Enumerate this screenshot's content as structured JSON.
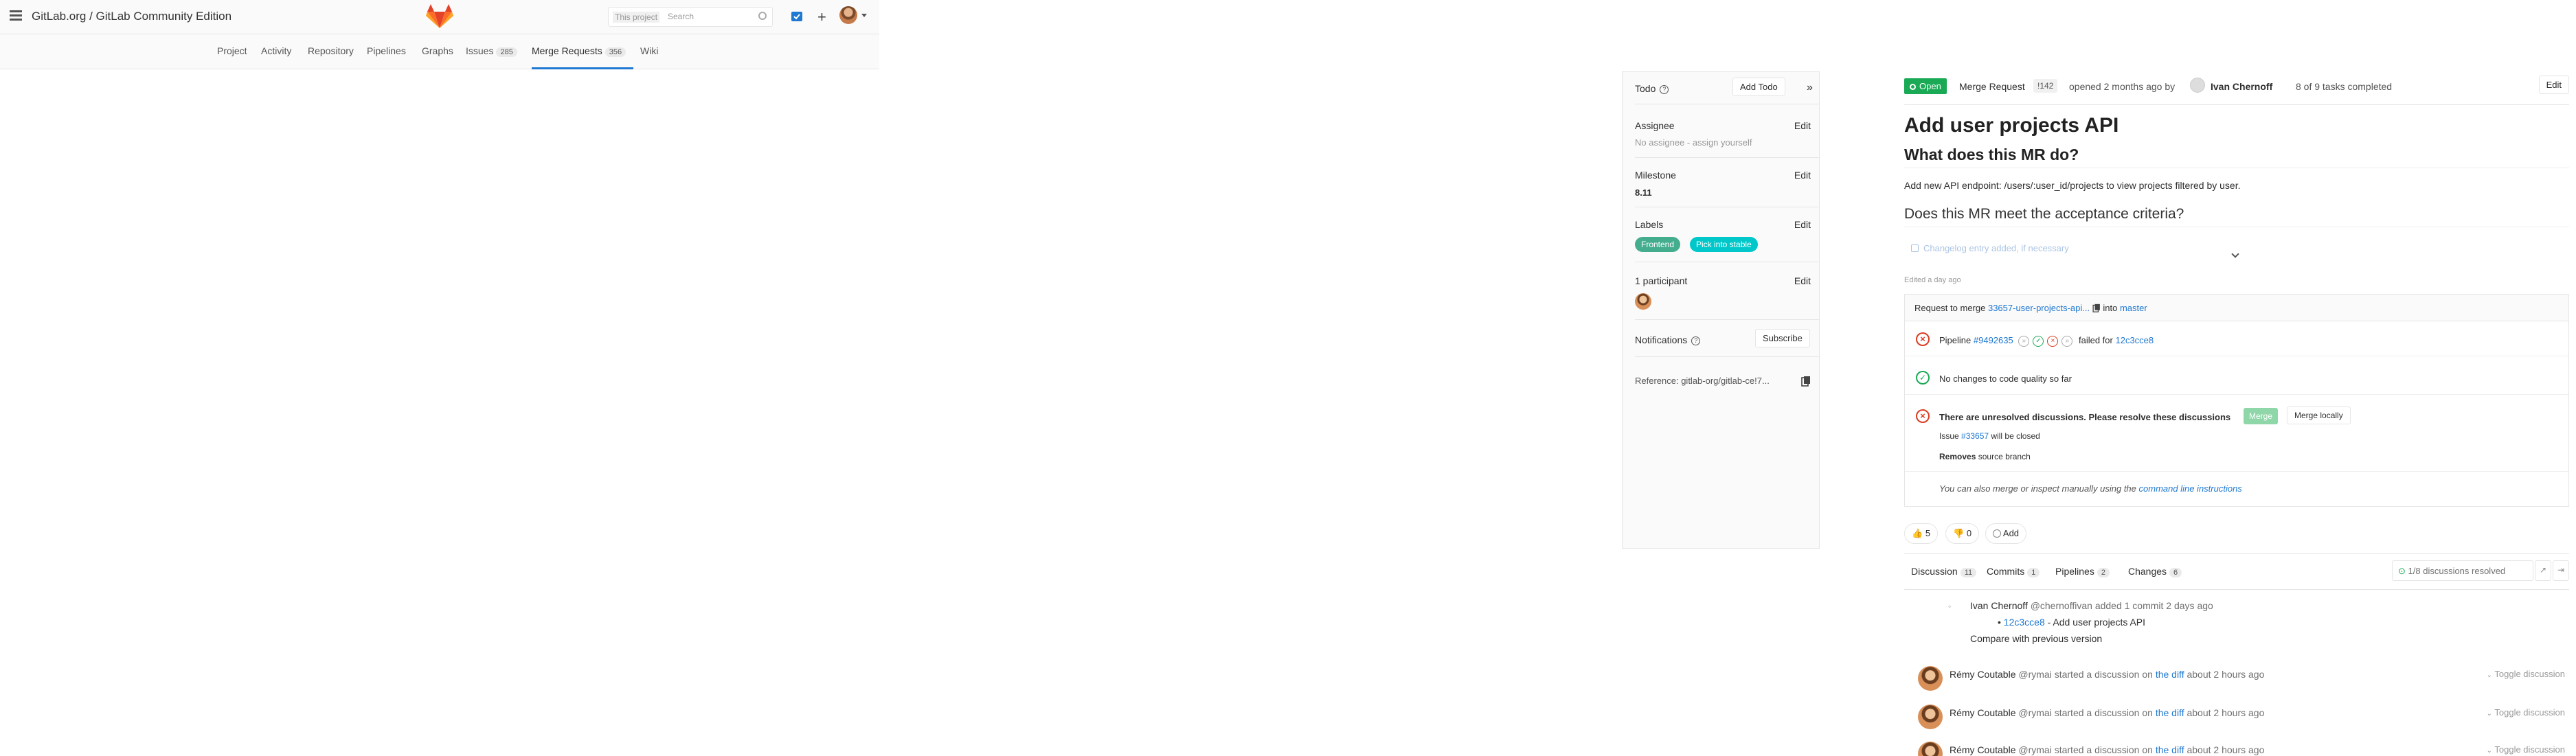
{
  "header": {
    "breadcrumb": "GitLab.org / GitLab Community Edition",
    "search_scope": "This project",
    "search_placeholder": "Search"
  },
  "project_nav": {
    "items": [
      {
        "label": "Project"
      },
      {
        "label": "Activity"
      },
      {
        "label": "Repository"
      },
      {
        "label": "Pipelines"
      },
      {
        "label": "Graphs"
      },
      {
        "label": "Issues",
        "count": "285"
      },
      {
        "label": "Merge Requests",
        "count": "356"
      },
      {
        "label": "Wiki"
      }
    ],
    "active": "Merge Requests"
  },
  "sidebar": {
    "todo_label": "Todo",
    "add_todo": "Add Todo",
    "collapse": "»",
    "assignee_label": "Assignee",
    "assignee_value": "No assignee - assign yourself",
    "milestone_label": "Milestone",
    "milestone_value": "8.11",
    "labels_label": "Labels",
    "labels": [
      {
        "text": "Frontend",
        "color": "#44ad8e"
      },
      {
        "text": "Pick into stable",
        "color": "#00c8ca"
      }
    ],
    "participants_label": "1 participant",
    "notifications_label": "Notifications",
    "subscribe": "Subscribe",
    "reference": "Reference: gitlab-org/gitlab-ce!7...",
    "edit": "Edit"
  },
  "mr": {
    "status": "Open",
    "type": "Merge Request",
    "id": "!142",
    "opened": "opened 2 months ago by",
    "author": "Ivan Chernoff",
    "tasks": "8 of 9 tasks completed",
    "edit_button": "Edit",
    "title": "Add user projects API",
    "h2_what": "What does this MR do?",
    "description": "Add new API endpoint: /users/:user_id/projects to view projects filtered by user.",
    "h2_criteria": "Does this MR meet the acceptance criteria?",
    "task_faded": "Changelog entry added, if necessary",
    "edited": "Edited a day ago"
  },
  "widget": {
    "request_prefix": "Request to merge",
    "source_branch": "33657-user-projects-api...",
    "into": "into",
    "target_branch": "master",
    "pipeline_label": "Pipeline",
    "pipeline_id": "#9492635",
    "pipeline_failed": "failed for",
    "commit_sha": "12c3cce8",
    "code_quality": "No changes to code quality so far",
    "unresolved": "There are unresolved discussions. Please resolve these discussions",
    "merge_button": "Merge",
    "merge_locally": "Merge locally",
    "issue_prefix": "Issue",
    "issue_ref": "#33657",
    "issue_suffix": "will be closed",
    "removes_bold": "Removes",
    "removes_rest": "source branch",
    "manual_text": "You can also merge or inspect manually using the",
    "manual_link": "command line instructions"
  },
  "awards": {
    "thumbs_up": "5",
    "thumbs_down": "0",
    "add": "Add"
  },
  "tabs": [
    {
      "label": "Discussion",
      "count": "11"
    },
    {
      "label": "Commits",
      "count": "1"
    },
    {
      "label": "Pipelines",
      "count": "2"
    },
    {
      "label": "Changes",
      "count": "6"
    }
  ],
  "resolved": "1/8 discussions resolved",
  "system_note": {
    "author": "Ivan Chernoff",
    "username": "@chernoffivan",
    "action": "added 1 commit 2 days ago",
    "commit_sha": "12c3cce8",
    "commit_msg": "- Add user projects API",
    "compare": "Compare with previous version"
  },
  "discussions": [
    {
      "author": "Rémy Coutable",
      "username": "@rymai",
      "action": "started a discussion on",
      "link": "the diff",
      "time": "about 2 hours ago",
      "toggle": "Toggle discussion"
    },
    {
      "author": "Rémy Coutable",
      "username": "@rymai",
      "action": "started a discussion on",
      "link": "the diff",
      "time": "about 2 hours ago",
      "toggle": "Toggle discussion"
    },
    {
      "author": "Rémy Coutable",
      "username": "@rymai",
      "action": "started a discussion on",
      "link": "the diff",
      "time": "about 2 hours ago",
      "toggle": "Toggle discussion"
    }
  ],
  "colors": {
    "accent": "#1f78d1",
    "success": "#1aaa55",
    "danger": "#db3b21"
  },
  "icons": [
    "hamburger-icon",
    "gitlab-logo-icon",
    "search-icon",
    "todos-icon",
    "plus-icon",
    "clipboard-icon",
    "thumbs-up-icon",
    "thumbs-down-icon",
    "smile-icon",
    "commit-icon",
    "chevron-down-icon"
  ]
}
